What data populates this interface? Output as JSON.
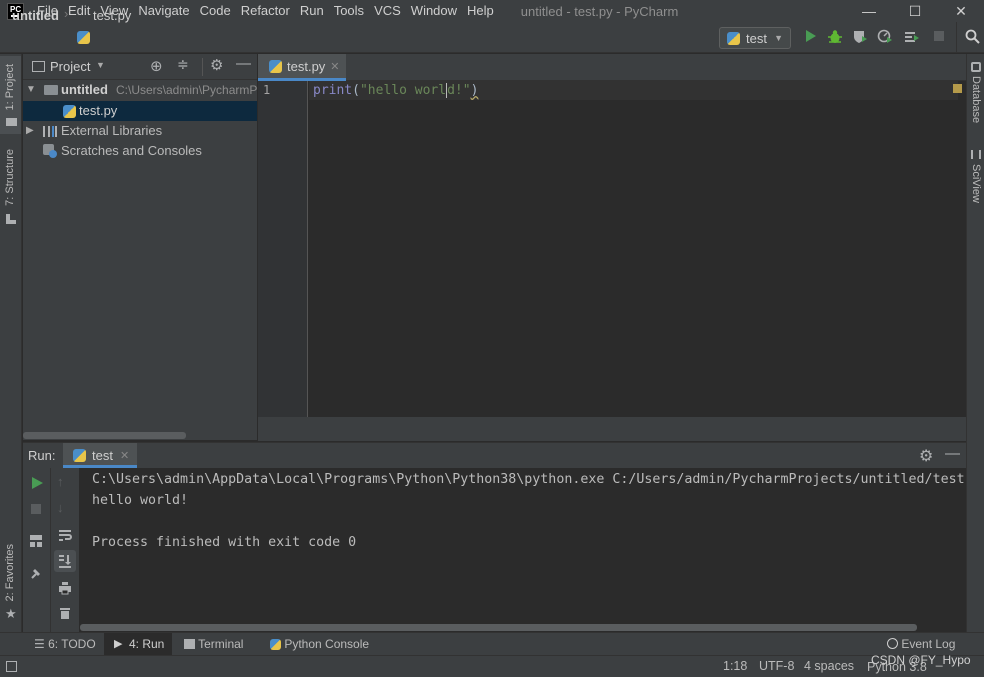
{
  "titlebar": {
    "logo": "PC",
    "menus": [
      "File",
      "Edit",
      "View",
      "Navigate",
      "Code",
      "Refactor",
      "Run",
      "Tools",
      "VCS",
      "Window",
      "Help"
    ],
    "title": "untitled - test.py - PyCharm",
    "controls": [
      "—",
      "☐",
      "✕"
    ]
  },
  "navbar": {
    "project": "untitled",
    "file": "test.py",
    "run_config": "test"
  },
  "left_tabs": {
    "project": "1: Project",
    "structure": "7: Structure",
    "favorites": "2: Favorites"
  },
  "right_tabs": {
    "database": "Database",
    "sciview": "SciView"
  },
  "project_panel": {
    "title": "Project",
    "root_name": "untitled",
    "root_path": "C:\\Users\\admin\\PycharmProjects\\untitled",
    "items": [
      {
        "label": "test.py"
      },
      {
        "label": "External Libraries"
      },
      {
        "label": "Scratches and Consoles"
      }
    ]
  },
  "editor": {
    "tab": "test.py",
    "line_number": "1",
    "code": {
      "func": "print",
      "open": "(",
      "str_a": "\"hello wor",
      "str_b": "l",
      "str_c": "d!\"",
      "close": ")"
    }
  },
  "run_panel": {
    "label": "Run:",
    "tab": "test",
    "console": [
      "C:\\Users\\admin\\AppData\\Local\\Programs\\Python\\Python38\\python.exe C:/Users/admin/PycharmProjects/untitled/test",
      "hello world!",
      "",
      "Process finished with exit code 0"
    ]
  },
  "bottom_tabs": [
    {
      "label": "6: TODO"
    },
    {
      "label": "4: Run"
    },
    {
      "label": "Terminal"
    },
    {
      "label": "Python Console"
    }
  ],
  "event_log": "Event Log",
  "status": {
    "position": "1:18",
    "encoding": "UTF-8",
    "indent": "4 spaces",
    "interpreter": "Python 3.8",
    "watermark": "CSDN @FY_Hypo"
  },
  "colors": {
    "accent": "#4a88c7",
    "run_green": "#499c54",
    "debug_green": "#5fb832",
    "keyword": "#8888c6",
    "string": "#6a8759",
    "selection": "#0d293e"
  }
}
